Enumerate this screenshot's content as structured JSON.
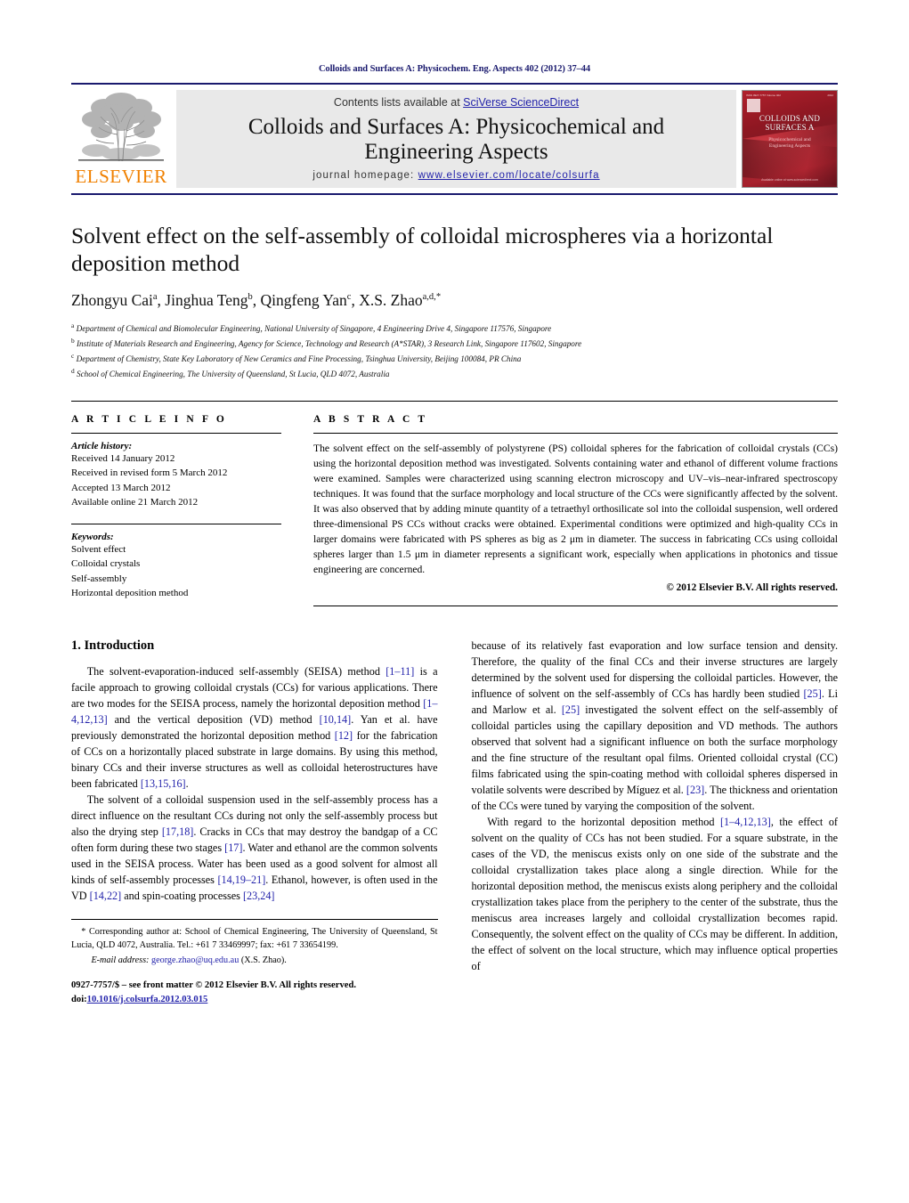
{
  "running_head": "Colloids and Surfaces A: Physicochem. Eng. Aspects 402 (2012) 37–44",
  "masthead": {
    "publisher_name": "ELSEVIER",
    "contents_prefix": "Contents lists available at ",
    "contents_link": "SciVerse ScienceDirect",
    "journal_title_line1": "Colloids and Surfaces A: Physicochemical and",
    "journal_title_line2": "Engineering Aspects",
    "homepage_prefix": "journal homepage: ",
    "homepage_url": "www.elsevier.com/locate/colsurfa",
    "cover": {
      "top_left": "ISSN 0927-7757   Volume 402",
      "top_right": "2012",
      "title_line1": "COLLOIDS AND",
      "title_line2": "SURFACES A",
      "sub_line1": "Physicochemical and",
      "sub_line2": "Engineering Aspects",
      "footer": "Available online at www.sciencedirect.com"
    }
  },
  "article": {
    "title": "Solvent effect on the self-assembly of colloidal microspheres via a horizontal deposition method",
    "authors": [
      {
        "name": "Zhongyu Cai",
        "sup": "a",
        "sep": ", "
      },
      {
        "name": "Jinghua Teng",
        "sup": "b",
        "sep": ", "
      },
      {
        "name": "Qingfeng Yan",
        "sup": "c",
        "sep": ", "
      },
      {
        "name": "X.S. Zhao",
        "sup": "a,d,",
        "sep": ""
      }
    ],
    "author_star": "*",
    "affiliations": [
      {
        "mark": "a",
        "text": "Department of Chemical and Biomolecular Engineering, National University of Singapore, 4 Engineering Drive 4, Singapore 117576, Singapore"
      },
      {
        "mark": "b",
        "text": "Institute of Materials Research and Engineering, Agency for Science, Technology and Research (A*STAR), 3 Research Link, Singapore 117602, Singapore"
      },
      {
        "mark": "c",
        "text": "Department of Chemistry, State Key Laboratory of New Ceramics and Fine Processing, Tsinghua University, Beijing 100084, PR China"
      },
      {
        "mark": "d",
        "text": "School of Chemical Engineering, The University of Queensland, St Lucia, QLD 4072, Australia"
      }
    ]
  },
  "article_info": {
    "heading": "A R T I C L E   I N F O",
    "history_label": "Article history:",
    "history": [
      "Received 14 January 2012",
      "Received in revised form 5 March 2012",
      "Accepted 13 March 2012",
      "Available online 21 March 2012"
    ],
    "keywords_label": "Keywords:",
    "keywords": [
      "Solvent effect",
      "Colloidal crystals",
      "Self-assembly",
      "Horizontal deposition method"
    ]
  },
  "abstract": {
    "heading": "A B S T R A C T",
    "text": "The solvent effect on the self-assembly of polystyrene (PS) colloidal spheres for the fabrication of colloidal crystals (CCs) using the horizontal deposition method was investigated. Solvents containing water and ethanol of different volume fractions were examined. Samples were characterized using scanning electron microscopy and UV–vis–near-infrared spectroscopy techniques. It was found that the surface morphology and local structure of the CCs were significantly affected by the solvent. It was also observed that by adding minute quantity of a tetraethyl orthosilicate sol into the colloidal suspension, well ordered three-dimensional PS CCs without cracks were obtained. Experimental conditions were optimized and high-quality CCs in larger domains were fabricated with PS spheres as big as 2 μm in diameter. The success in fabricating CCs using colloidal spheres larger than 1.5 μm in diameter represents a significant work, especially when applications in photonics and tissue engineering are concerned.",
    "copyright": "© 2012 Elsevier B.V. All rights reserved."
  },
  "body": {
    "section_number_title": "1.  Introduction",
    "left_paragraphs": [
      "The solvent-evaporation-induced self-assembly (SEISA) method [1–11] is a facile approach to growing colloidal crystals (CCs) for various applications. There are two modes for the SEISA process, namely the horizontal deposition method [1–4,12,13] and the vertical deposition (VD) method [10,14]. Yan et al. have previously demonstrated the horizontal deposition method [12] for the fabrication of CCs on a horizontally placed substrate in large domains. By using this method, binary CCs and their inverse structures as well as colloidal heterostructures have been fabricated [13,15,16].",
      "The solvent of a colloidal suspension used in the self-assembly process has a direct influence on the resultant CCs during not only the self-assembly process but also the drying step [17,18]. Cracks in CCs that may destroy the bandgap of a CC often form during these two stages [17]. Water and ethanol are the common solvents used in the SEISA process. Water has been used as a good solvent for almost all kinds of self-assembly processes [14,19–21]. Ethanol, however, is often used in the VD [14,22] and spin-coating processes [23,24]"
    ],
    "right_paragraphs": [
      "because of its relatively fast evaporation and low surface tension and density. Therefore, the quality of the final CCs and their inverse structures are largely determined by the solvent used for dispersing the colloidal particles. However, the influence of solvent on the self-assembly of CCs has hardly been studied [25]. Li and Marlow et al. [25] investigated the solvent effect on the self-assembly of colloidal particles using the capillary deposition and VD methods. The authors observed that solvent had a significant influence on both the surface morphology and the fine structure of the resultant opal films. Oriented colloidal crystal (CC) films fabricated using the spin-coating method with colloidal spheres dispersed in volatile solvents were described by Míguez et al. [23]. The thickness and orientation of the CCs were tuned by varying the composition of the solvent.",
      "With regard to the horizontal deposition method [1–4,12,13], the effect of solvent on the quality of CCs has not been studied. For a square substrate, in the cases of the VD, the meniscus exists only on one side of the substrate and the colloidal crystallization takes place along a single direction. While for the horizontal deposition method, the meniscus exists along periphery and the colloidal crystallization takes place from the periphery to the center of the substrate, thus the meniscus area increases largely and colloidal crystallization becomes rapid. Consequently, the solvent effect on the quality of CCs may be different. In addition, the effect of solvent on the local structure, which may influence optical properties of"
    ]
  },
  "footnote": {
    "corresponding": "* Corresponding author at: School of Chemical Engineering, The University of Queensland, St Lucia, QLD 4072, Australia. Tel.: +61 7 33469997; fax: +61 7 33654199.",
    "email_label": "E-mail address:",
    "email": "george.zhao@uq.edu.au",
    "email_suffix": " (X.S. Zhao).",
    "issn_line": "0927-7757/$ – see front matter © 2012 Elsevier B.V. All rights reserved.",
    "doi_prefix": "doi:",
    "doi": "10.1016/j.colsurfa.2012.03.015"
  },
  "colors": {
    "link_blue": "#2222aa",
    "rule_navy": "#1a1a6e",
    "elsevier_orange": "#F08000",
    "band_gray": "#e9e9e9"
  }
}
